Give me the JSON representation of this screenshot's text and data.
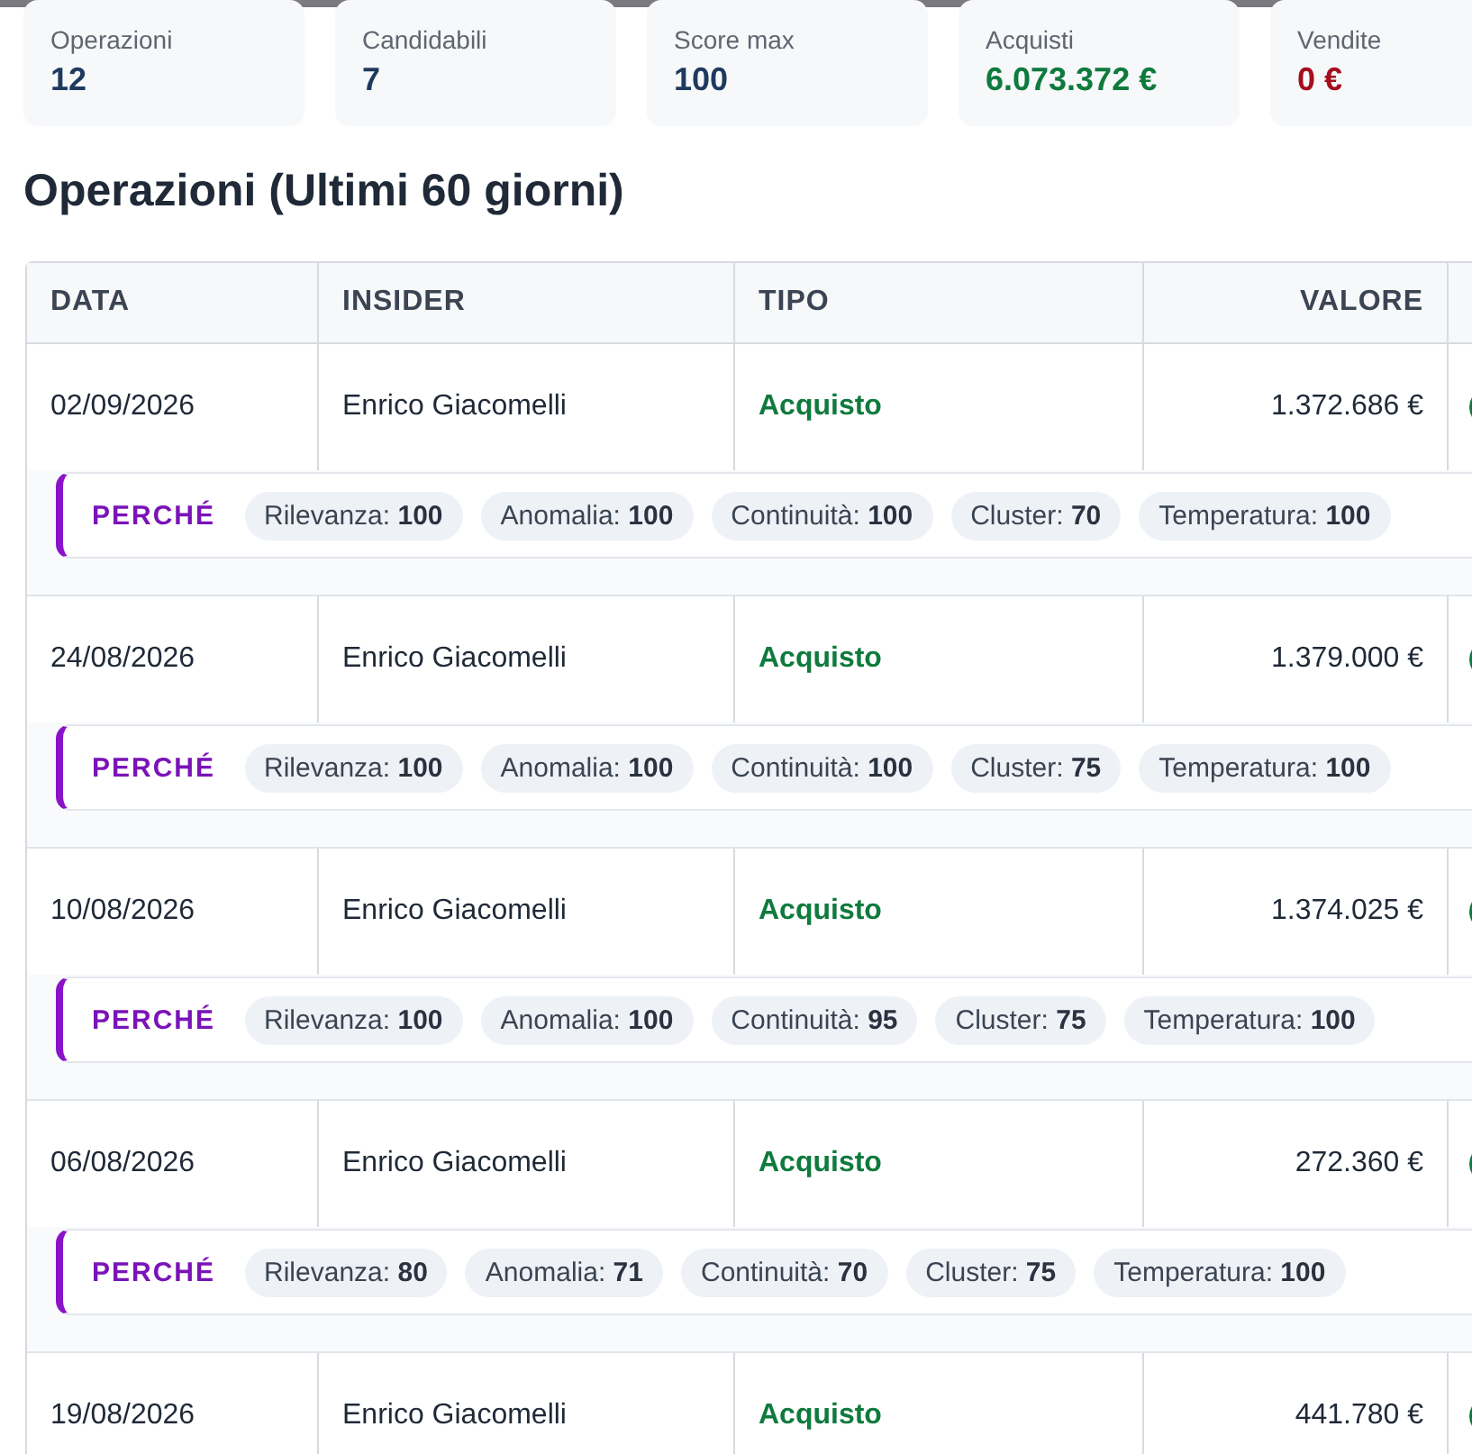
{
  "stats": [
    {
      "label": "Operazioni",
      "value": "12",
      "kind": "neutral"
    },
    {
      "label": "Candidabili",
      "value": "7",
      "kind": "neutral"
    },
    {
      "label": "Score max",
      "value": "100",
      "kind": "neutral"
    },
    {
      "label": "Acquisti",
      "value": "6.073.372 €",
      "kind": "positive"
    },
    {
      "label": "Vendite",
      "value": "0 €",
      "kind": "negative"
    }
  ],
  "section_title": "Operazioni (Ultimi 60 giorni)",
  "table": {
    "columns": [
      "DATA",
      "INSIDER",
      "TIPO",
      "VALORE"
    ],
    "rows": [
      {
        "date": "02/09/2026",
        "insider": "Enrico Giacomelli",
        "type": {
          "label": "Acquisto",
          "kind": "buy"
        },
        "value": "1.372.686 €",
        "why_label": "PERCHÉ",
        "factors": [
          {
            "name": "Rilevanza:",
            "score": "100"
          },
          {
            "name": "Anomalia:",
            "score": "100"
          },
          {
            "name": "Continuità:",
            "score": "100"
          },
          {
            "name": "Cluster:",
            "score": "70"
          },
          {
            "name": "Temperatura:",
            "score": "100"
          }
        ]
      },
      {
        "date": "24/08/2026",
        "insider": "Enrico Giacomelli",
        "type": {
          "label": "Acquisto",
          "kind": "buy"
        },
        "value": "1.379.000 €",
        "why_label": "PERCHÉ",
        "factors": [
          {
            "name": "Rilevanza:",
            "score": "100"
          },
          {
            "name": "Anomalia:",
            "score": "100"
          },
          {
            "name": "Continuità:",
            "score": "100"
          },
          {
            "name": "Cluster:",
            "score": "75"
          },
          {
            "name": "Temperatura:",
            "score": "100"
          }
        ]
      },
      {
        "date": "10/08/2026",
        "insider": "Enrico Giacomelli",
        "type": {
          "label": "Acquisto",
          "kind": "buy"
        },
        "value": "1.374.025 €",
        "why_label": "PERCHÉ",
        "factors": [
          {
            "name": "Rilevanza:",
            "score": "100"
          },
          {
            "name": "Anomalia:",
            "score": "100"
          },
          {
            "name": "Continuità:",
            "score": "95"
          },
          {
            "name": "Cluster:",
            "score": "75"
          },
          {
            "name": "Temperatura:",
            "score": "100"
          }
        ]
      },
      {
        "date": "06/08/2026",
        "insider": "Enrico Giacomelli",
        "type": {
          "label": "Acquisto",
          "kind": "buy"
        },
        "value": "272.360 €",
        "why_label": "PERCHÉ",
        "factors": [
          {
            "name": "Rilevanza:",
            "score": "80"
          },
          {
            "name": "Anomalia:",
            "score": "71"
          },
          {
            "name": "Continuità:",
            "score": "70"
          },
          {
            "name": "Cluster:",
            "score": "75"
          },
          {
            "name": "Temperatura:",
            "score": "100"
          }
        ]
      },
      {
        "date": "19/08/2026",
        "insider": "Enrico Giacomelli",
        "type": {
          "label": "Acquisto",
          "kind": "buy"
        },
        "value": "441.780 €"
      }
    ]
  }
}
